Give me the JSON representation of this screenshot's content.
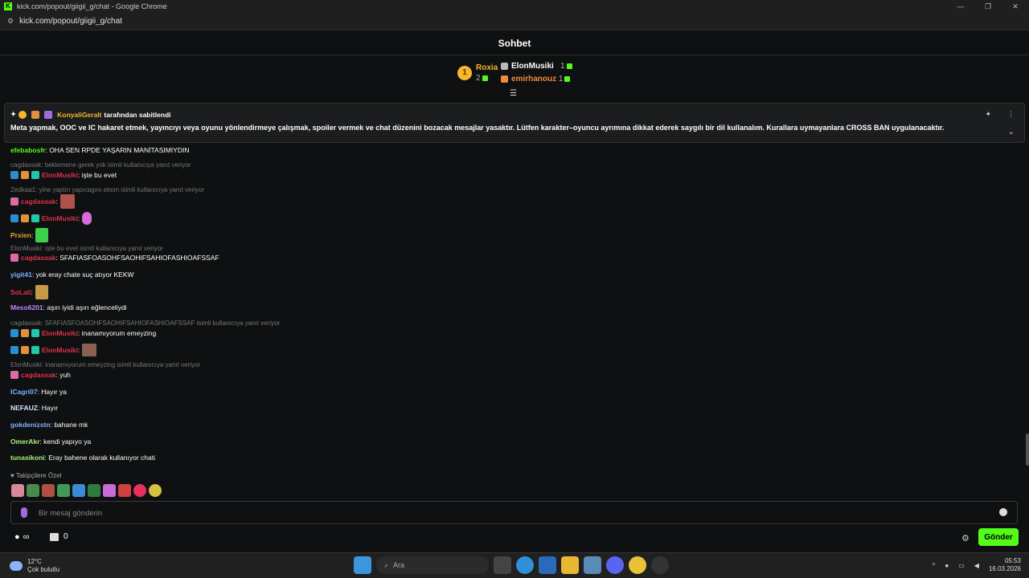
{
  "browser": {
    "window_title": "kick.com/popout/giigii_g/chat - Google Chrome",
    "url": "kick.com/popout/giigii_g/chat",
    "favicon_letter": "K"
  },
  "chat": {
    "title": "Sohbet",
    "leaderboard": {
      "first_rank": "1",
      "first_name": "Roxia",
      "first_count": "2",
      "second_name": "ElonMusiki",
      "second_count": "1",
      "third_name": "emirhanouz",
      "third_count": "1"
    },
    "pinned": {
      "pinned_by_user": "KonyaliGeralt",
      "pinned_by_suffix": "tarafından sabitlendi",
      "text": "Meta yapmak, OOC ve IC hakaret etmek, yayıncıyı veya oyunu yönlendirmeye çalışmak, spoiler vermek ve chat düzenini bozacak mesajlar yasaktır. Lütfen karakter–oyuncu ayrımına dikkat ederek saygılı bir dil kullanalım. Kurallara uymayanlara CROSS BAN uygulanacaktır."
    },
    "messages": [
      {
        "user": "efebabosfr",
        "color": "#53fc18",
        "text": ": OHA SEN RPDE YAŞARIN MANİTASIMIYDIN"
      },
      {
        "reply": "cagdassak: beklemene gerek yok  isimli kullanıcıya yanıt veriyor"
      },
      {
        "user": "ElonMusiki",
        "color": "#e0324b",
        "text": ": işte bu evet"
      },
      {
        "reply": "Zedkaa1: yine yaptın yapıcagını eloon isimli kullanıcıya yanıt veriyor"
      },
      {
        "user": "cagdassak",
        "color": "#e0324b",
        "text": ":"
      },
      {
        "user": "ElonMusiki",
        "color": "#e0324b",
        "text": ":"
      },
      {
        "user": "Prxien",
        "color": "#f0a030",
        "text": ":"
      },
      {
        "reply": "ElonMusiki: işte bu evet isimli kullanıcıya yanıt veriyor"
      },
      {
        "user": "cagdassak",
        "color": "#e0324b",
        "text": ": SFAFIASFOASOHFSAOHIFSAHIOFASHIOAFSSAF"
      },
      {
        "user": "yigit41",
        "color": "#7fb0ff",
        "text": ": yok eray chate suç atıyor KEKW"
      },
      {
        "user": "SoLali",
        "color": "#e0324b",
        "text": ":"
      },
      {
        "user": "Meso6201",
        "color": "#c08aff",
        "text": ": aşırı iyidi aşırı eğlenceliydi"
      },
      {
        "reply": "cagdassak: SFAFIASFOASOHFSAOHIFSAHIOFASHIOAFSSAF isimli kullanıcıya yanıt veriyor"
      },
      {
        "user": "ElonMusiki",
        "color": "#e0324b",
        "text": ": inanamıyorum emeyzing"
      },
      {
        "user": "ElonMusiki",
        "color": "#e0324b",
        "text": ":"
      },
      {
        "reply": "ElonMusiki: inanamıyorum emeyzing isimli kullanıcıya yanıt veriyor"
      },
      {
        "user": "cagdassak",
        "color": "#e0324b",
        "text": ": yuh"
      },
      {
        "user": "ICagri07",
        "color": "#7fb0ff",
        "text": ": Hayır ya"
      },
      {
        "user": "NEFAUZ",
        "color": "#cfe8ff",
        "text": ": Hayır"
      },
      {
        "user": "gokdenizstn",
        "color": "#7fb0ff",
        "text": ": bahane mk"
      },
      {
        "user": "OmerAkr",
        "color": "#a6f07a",
        "text": ": kendi yapıyo ya"
      },
      {
        "user": "tunasikoni",
        "color": "#a6f07a",
        "text": ": Eray bahene olarak kullanıyor chati"
      }
    ],
    "followers_only_label": "Takipçilere Özel",
    "input_placeholder": "Bir mesaj gönderin",
    "points_count": "0",
    "send_label": "Gönder",
    "accent_color": "#53fc18"
  },
  "taskbar": {
    "temperature": "12°C",
    "weather": "Çok bulutlu",
    "search_placeholder": "Ara",
    "time": "05:53",
    "date": "16.03.2026"
  },
  "icons": [
    "pin-icon",
    "more-icon",
    "chevron-down-icon",
    "mic-icon",
    "emoji-icon",
    "settings-icon",
    "store-icon",
    "infinity-icon"
  ]
}
